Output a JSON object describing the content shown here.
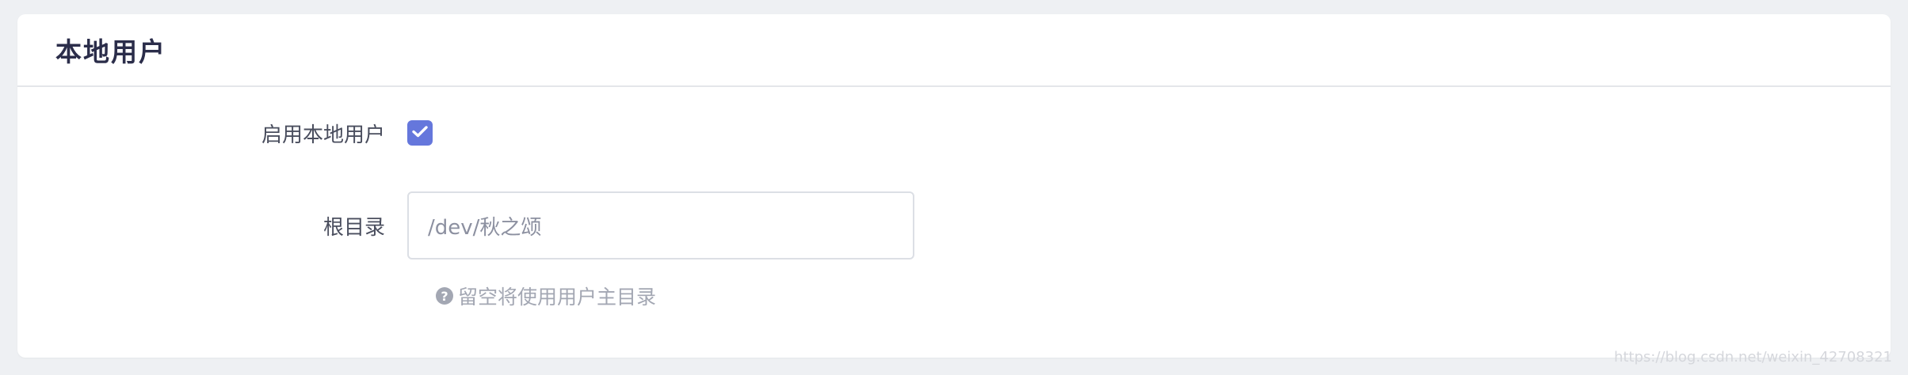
{
  "card": {
    "title": "本地用户"
  },
  "enable_local_user": {
    "label": "启用本地用户",
    "checked": true
  },
  "root_dir": {
    "label": "根目录",
    "value": "/dev/秋之颂",
    "help": "留空将使用用户主目录"
  },
  "icons": {
    "checkbox": "check-icon",
    "help": "question-circle-icon"
  },
  "colors": {
    "accent": "#6577dc",
    "title": "#2b2d4a",
    "label": "#4a4e5e",
    "help": "#a3a7b3"
  },
  "watermark": "https://blog.csdn.net/weixin_42708321"
}
